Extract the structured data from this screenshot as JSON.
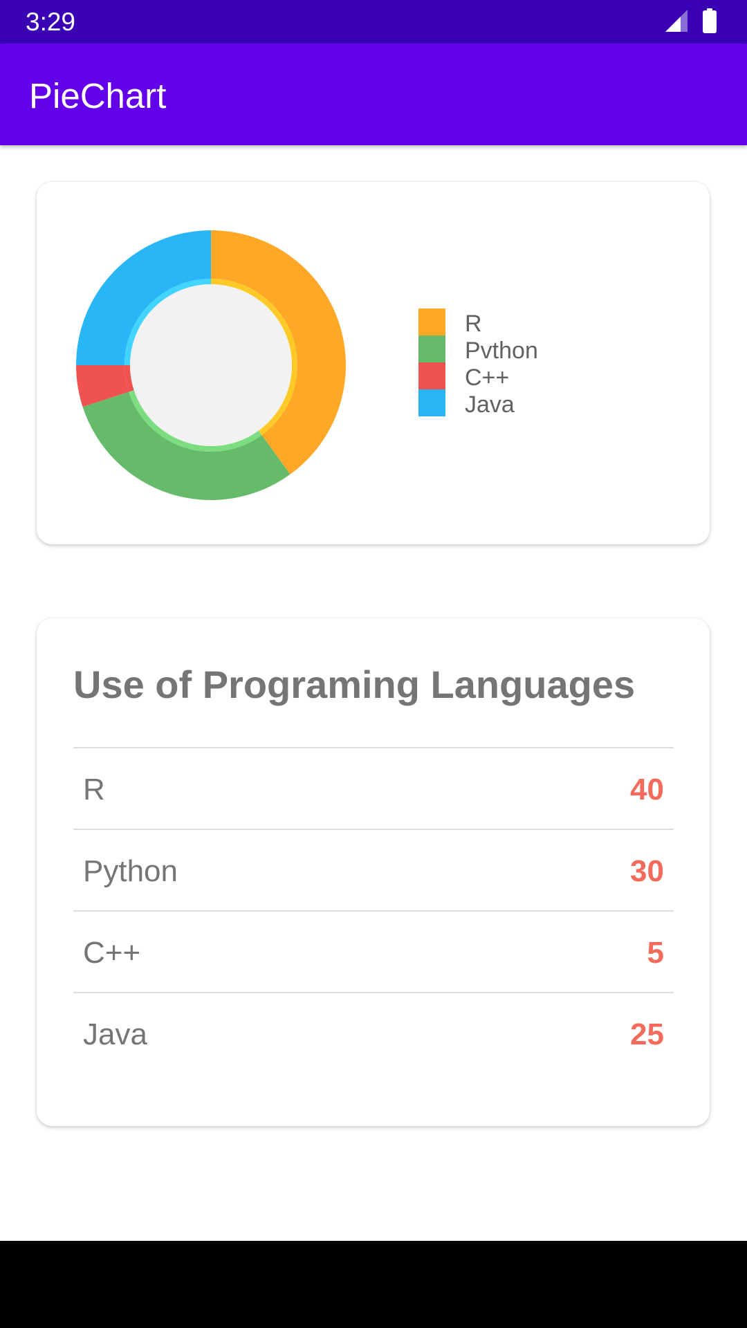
{
  "status_bar": {
    "time": "3:29"
  },
  "app_bar": {
    "title": "PieChart"
  },
  "colors": {
    "status_bar": "#3a00b3",
    "app_bar": "#6200ea",
    "accent_value": "#f26b5b"
  },
  "chart_data": {
    "type": "pie",
    "style": "donut",
    "categories": [
      "R",
      "Pvthon",
      "C++",
      "Java"
    ],
    "values": [
      40,
      30,
      5,
      25
    ],
    "colors": [
      "#ffa726",
      "#66bb6a",
      "#ef5350",
      "#29b6f6"
    ],
    "inner_colors": [
      "#ffca28",
      "#7cdc80",
      "#ef5350",
      "#40d4ff"
    ],
    "legend": "right",
    "title": "",
    "hole_color": "#f2f2f2"
  },
  "table": {
    "title": "Use of Programing Languages",
    "rows": [
      {
        "name": "R",
        "value": "40"
      },
      {
        "name": "Python",
        "value": "30"
      },
      {
        "name": "C++",
        "value": "5"
      },
      {
        "name": "Java",
        "value": "25"
      }
    ]
  }
}
